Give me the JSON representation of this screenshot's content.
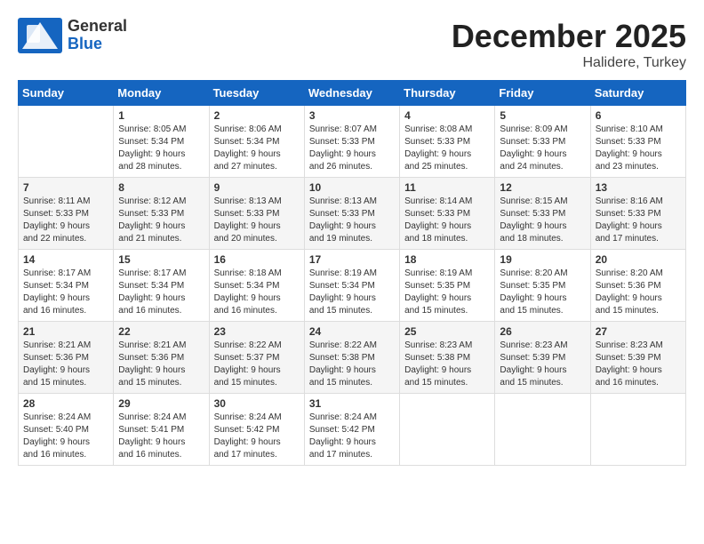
{
  "header": {
    "logo_general": "General",
    "logo_blue": "Blue",
    "month": "December 2025",
    "location": "Halidere, Turkey"
  },
  "weekdays": [
    "Sunday",
    "Monday",
    "Tuesday",
    "Wednesday",
    "Thursday",
    "Friday",
    "Saturday"
  ],
  "weeks": [
    [
      {
        "day": "",
        "info": ""
      },
      {
        "day": "1",
        "info": "Sunrise: 8:05 AM\nSunset: 5:34 PM\nDaylight: 9 hours\nand 28 minutes."
      },
      {
        "day": "2",
        "info": "Sunrise: 8:06 AM\nSunset: 5:34 PM\nDaylight: 9 hours\nand 27 minutes."
      },
      {
        "day": "3",
        "info": "Sunrise: 8:07 AM\nSunset: 5:33 PM\nDaylight: 9 hours\nand 26 minutes."
      },
      {
        "day": "4",
        "info": "Sunrise: 8:08 AM\nSunset: 5:33 PM\nDaylight: 9 hours\nand 25 minutes."
      },
      {
        "day": "5",
        "info": "Sunrise: 8:09 AM\nSunset: 5:33 PM\nDaylight: 9 hours\nand 24 minutes."
      },
      {
        "day": "6",
        "info": "Sunrise: 8:10 AM\nSunset: 5:33 PM\nDaylight: 9 hours\nand 23 minutes."
      }
    ],
    [
      {
        "day": "7",
        "info": "Sunrise: 8:11 AM\nSunset: 5:33 PM\nDaylight: 9 hours\nand 22 minutes."
      },
      {
        "day": "8",
        "info": "Sunrise: 8:12 AM\nSunset: 5:33 PM\nDaylight: 9 hours\nand 21 minutes."
      },
      {
        "day": "9",
        "info": "Sunrise: 8:13 AM\nSunset: 5:33 PM\nDaylight: 9 hours\nand 20 minutes."
      },
      {
        "day": "10",
        "info": "Sunrise: 8:13 AM\nSunset: 5:33 PM\nDaylight: 9 hours\nand 19 minutes."
      },
      {
        "day": "11",
        "info": "Sunrise: 8:14 AM\nSunset: 5:33 PM\nDaylight: 9 hours\nand 18 minutes."
      },
      {
        "day": "12",
        "info": "Sunrise: 8:15 AM\nSunset: 5:33 PM\nDaylight: 9 hours\nand 18 minutes."
      },
      {
        "day": "13",
        "info": "Sunrise: 8:16 AM\nSunset: 5:33 PM\nDaylight: 9 hours\nand 17 minutes."
      }
    ],
    [
      {
        "day": "14",
        "info": "Sunrise: 8:17 AM\nSunset: 5:34 PM\nDaylight: 9 hours\nand 16 minutes."
      },
      {
        "day": "15",
        "info": "Sunrise: 8:17 AM\nSunset: 5:34 PM\nDaylight: 9 hours\nand 16 minutes."
      },
      {
        "day": "16",
        "info": "Sunrise: 8:18 AM\nSunset: 5:34 PM\nDaylight: 9 hours\nand 16 minutes."
      },
      {
        "day": "17",
        "info": "Sunrise: 8:19 AM\nSunset: 5:34 PM\nDaylight: 9 hours\nand 15 minutes."
      },
      {
        "day": "18",
        "info": "Sunrise: 8:19 AM\nSunset: 5:35 PM\nDaylight: 9 hours\nand 15 minutes."
      },
      {
        "day": "19",
        "info": "Sunrise: 8:20 AM\nSunset: 5:35 PM\nDaylight: 9 hours\nand 15 minutes."
      },
      {
        "day": "20",
        "info": "Sunrise: 8:20 AM\nSunset: 5:36 PM\nDaylight: 9 hours\nand 15 minutes."
      }
    ],
    [
      {
        "day": "21",
        "info": "Sunrise: 8:21 AM\nSunset: 5:36 PM\nDaylight: 9 hours\nand 15 minutes."
      },
      {
        "day": "22",
        "info": "Sunrise: 8:21 AM\nSunset: 5:36 PM\nDaylight: 9 hours\nand 15 minutes."
      },
      {
        "day": "23",
        "info": "Sunrise: 8:22 AM\nSunset: 5:37 PM\nDaylight: 9 hours\nand 15 minutes."
      },
      {
        "day": "24",
        "info": "Sunrise: 8:22 AM\nSunset: 5:38 PM\nDaylight: 9 hours\nand 15 minutes."
      },
      {
        "day": "25",
        "info": "Sunrise: 8:23 AM\nSunset: 5:38 PM\nDaylight: 9 hours\nand 15 minutes."
      },
      {
        "day": "26",
        "info": "Sunrise: 8:23 AM\nSunset: 5:39 PM\nDaylight: 9 hours\nand 15 minutes."
      },
      {
        "day": "27",
        "info": "Sunrise: 8:23 AM\nSunset: 5:39 PM\nDaylight: 9 hours\nand 16 minutes."
      }
    ],
    [
      {
        "day": "28",
        "info": "Sunrise: 8:24 AM\nSunset: 5:40 PM\nDaylight: 9 hours\nand 16 minutes."
      },
      {
        "day": "29",
        "info": "Sunrise: 8:24 AM\nSunset: 5:41 PM\nDaylight: 9 hours\nand 16 minutes."
      },
      {
        "day": "30",
        "info": "Sunrise: 8:24 AM\nSunset: 5:42 PM\nDaylight: 9 hours\nand 17 minutes."
      },
      {
        "day": "31",
        "info": "Sunrise: 8:24 AM\nSunset: 5:42 PM\nDaylight: 9 hours\nand 17 minutes."
      },
      {
        "day": "",
        "info": ""
      },
      {
        "day": "",
        "info": ""
      },
      {
        "day": "",
        "info": ""
      }
    ]
  ]
}
